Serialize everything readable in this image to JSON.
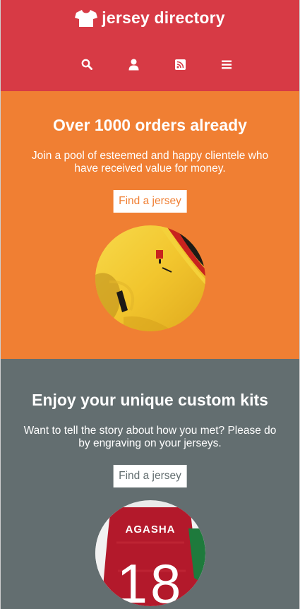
{
  "header": {
    "brand_name": "jersey directory",
    "brand_icon": "tshirt-icon",
    "nav": [
      {
        "icon": "search-icon"
      },
      {
        "icon": "user-icon"
      },
      {
        "icon": "rss-icon"
      },
      {
        "icon": "menu-icon"
      }
    ],
    "background": "#d73a45"
  },
  "sections": [
    {
      "title": "Over 1000 orders already",
      "text": "Join a pool of esteemed and happy clientele who have received value for money.",
      "button_label": "Find a jersey",
      "image": "yellow-jersey-photo",
      "background": "#f07f33"
    },
    {
      "title": "Enjoy your unique custom kits",
      "text": "Want to tell the story about how you met? Please do by engraving on your jerseys.",
      "button_label": "Find a jersey",
      "image": "red-jersey-photo",
      "image_name_text": "AGASHA",
      "image_number_text": "18",
      "background": "#636e70"
    }
  ]
}
